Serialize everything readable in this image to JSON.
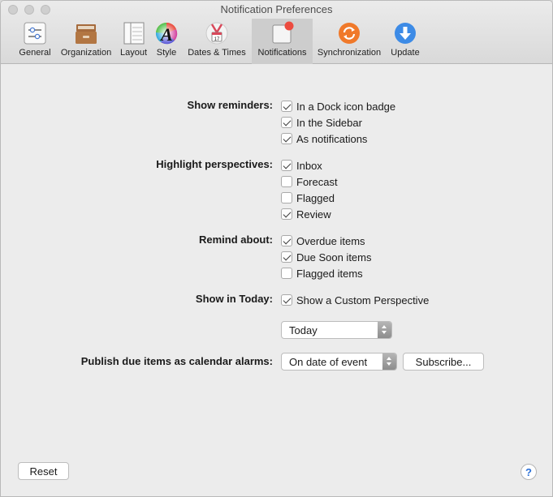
{
  "window": {
    "title": "Notification Preferences"
  },
  "toolbar": {
    "items": [
      {
        "label": "General",
        "icon": "sliders-icon"
      },
      {
        "label": "Organization",
        "icon": "file-cabinet-icon"
      },
      {
        "label": "Layout",
        "icon": "layout-icon"
      },
      {
        "label": "Style",
        "icon": "style-font-icon"
      },
      {
        "label": "Dates & Times",
        "icon": "calendar-icon"
      },
      {
        "label": "Notifications",
        "icon": "notifications-badge-icon",
        "selected": true
      },
      {
        "label": "Synchronization",
        "icon": "sync-icon"
      },
      {
        "label": "Update",
        "icon": "download-arrow-icon"
      }
    ]
  },
  "show_reminders": {
    "label": "Show reminders:",
    "options": [
      {
        "text": "In a Dock icon badge",
        "checked": true
      },
      {
        "text": "In the Sidebar",
        "checked": true
      },
      {
        "text": "As notifications",
        "checked": true
      }
    ]
  },
  "highlight_perspectives": {
    "label": "Highlight perspectives:",
    "options": [
      {
        "text": "Inbox",
        "checked": true
      },
      {
        "text": "Forecast",
        "checked": false
      },
      {
        "text": "Flagged",
        "checked": false
      },
      {
        "text": "Review",
        "checked": true
      }
    ]
  },
  "remind_about": {
    "label": "Remind about:",
    "options": [
      {
        "text": "Overdue items",
        "checked": true
      },
      {
        "text": "Due Soon items",
        "checked": true
      },
      {
        "text": "Flagged items",
        "checked": false
      }
    ]
  },
  "show_in_today": {
    "label": "Show in Today:",
    "option": {
      "text": "Show a Custom Perspective",
      "checked": true
    },
    "perspective_value": "Today"
  },
  "publish": {
    "label": "Publish due items as calendar alarms:",
    "value": "On date of event",
    "subscribe_label": "Subscribe..."
  },
  "footer": {
    "reset_label": "Reset",
    "help_label": "?"
  },
  "colors": {
    "accent_blue": "#2a6fd6",
    "badge_red": "#ec4b3f",
    "sync_orange": "#f0792a",
    "update_blue": "#3d8be6"
  }
}
